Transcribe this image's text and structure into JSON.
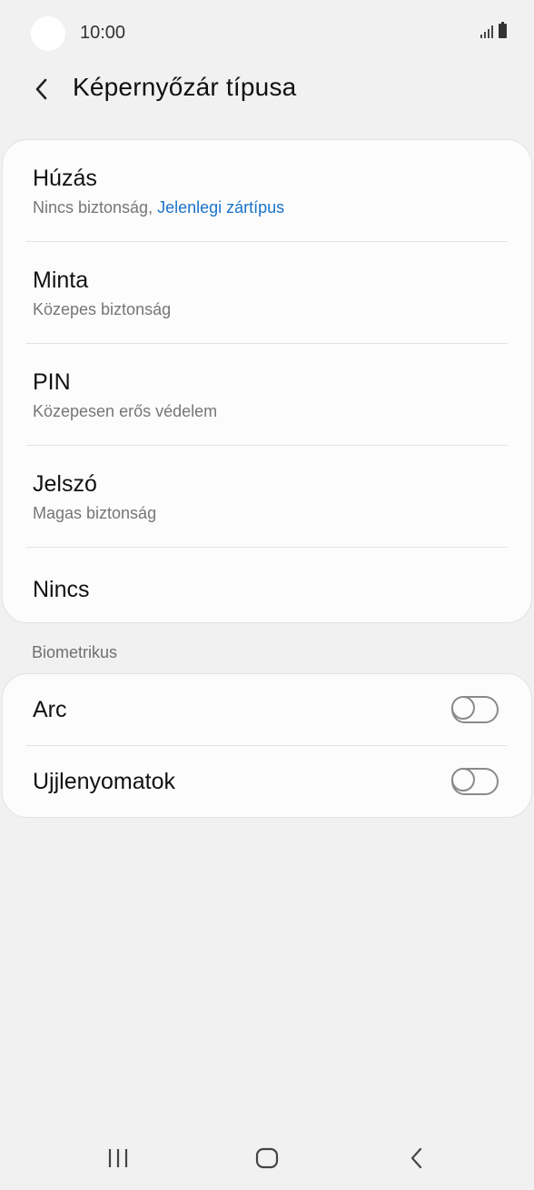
{
  "status_bar": {
    "time": "10:00"
  },
  "header": {
    "title": "Képernyőzár típusa"
  },
  "lock_types": [
    {
      "title": "Húzás",
      "subtitle": "Nincs biztonság, ",
      "subtitle_accent": "Jelenlegi zártípus"
    },
    {
      "title": "Minta",
      "subtitle": "Közepes biztonság"
    },
    {
      "title": "PIN",
      "subtitle": "Közepesen erős védelem"
    },
    {
      "title": "Jelszó",
      "subtitle": "Magas biztonság"
    },
    {
      "title": "Nincs"
    }
  ],
  "biometrics": {
    "label": "Biometrikus",
    "items": [
      {
        "title": "Arc",
        "enabled": false
      },
      {
        "title": "Ujjlenyomatok",
        "enabled": false
      }
    ]
  },
  "colors": {
    "accent": "#1a73c9",
    "background": "#f1f1f1",
    "card": "#fcfcfc"
  },
  "icons": {
    "back": "chevron-left-icon",
    "nav_recent": "recent-apps-icon",
    "nav_home": "home-icon",
    "nav_back": "back-icon"
  }
}
